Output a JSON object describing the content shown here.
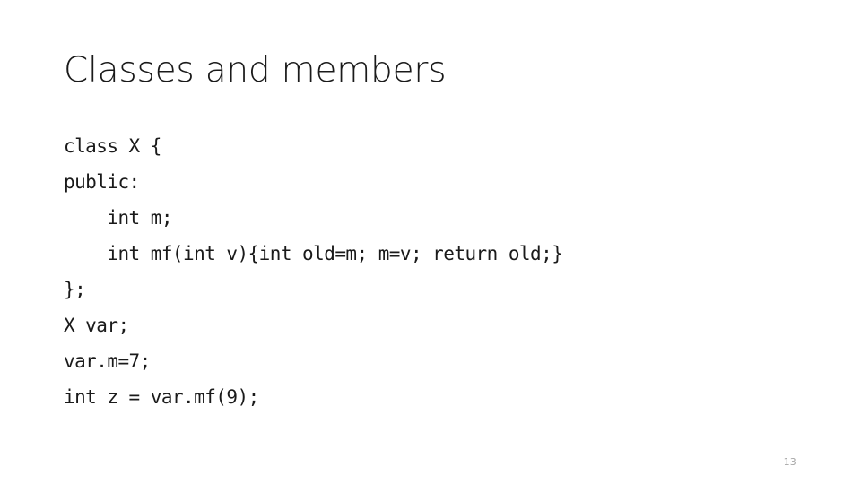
{
  "slide": {
    "title": "Classes and members",
    "page_number": "13",
    "code_lines": [
      "class X {",
      "public:",
      "    int m;",
      "    int mf(int v){int old=m; m=v; return old;}",
      "};",
      "X var;",
      "var.m=7;",
      "int z = var.mf(9);"
    ],
    "colors": {
      "background": "#ffffff",
      "title_text": "#1a1a1a",
      "code_text": "#1a1a1a",
      "page_number_text": "#a6a6a6"
    }
  }
}
